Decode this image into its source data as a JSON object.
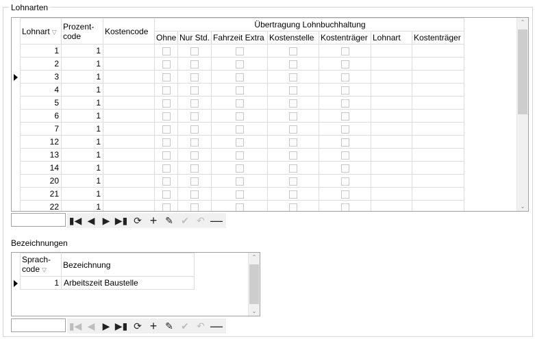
{
  "window": {
    "group_title": "Lohnarten",
    "section2_title": "Bezeichnungen"
  },
  "grid1": {
    "headers": {
      "lohnart": "Lohnart",
      "prozentcode": "Prozent-\ncode",
      "kostencode": "Kostencode",
      "uebertragung": "Übertragung Lohnbuchhaltung",
      "ohne": "Ohne",
      "nur_std": "Nur Std.",
      "fahrzeit_extra": "Fahrzeit Extra",
      "kostenstelle": "Kostenstelle",
      "kostentraeger": "Kostenträger",
      "lohnart2": "Lohnart",
      "kostentraeger2": "Kostenträger"
    },
    "rows": [
      {
        "lohnart": "1",
        "prozentcode": "1"
      },
      {
        "lohnart": "2",
        "prozentcode": "1"
      },
      {
        "lohnart": "3",
        "prozentcode": "1"
      },
      {
        "lohnart": "4",
        "prozentcode": "1"
      },
      {
        "lohnart": "5",
        "prozentcode": "1"
      },
      {
        "lohnart": "6",
        "prozentcode": "1"
      },
      {
        "lohnart": "7",
        "prozentcode": "1"
      },
      {
        "lohnart": "12",
        "prozentcode": "1"
      },
      {
        "lohnart": "13",
        "prozentcode": "1"
      },
      {
        "lohnart": "14",
        "prozentcode": "1"
      },
      {
        "lohnart": "20",
        "prozentcode": "1"
      },
      {
        "lohnart": "21",
        "prozentcode": "1"
      },
      {
        "lohnart": "22",
        "prozentcode": "1"
      }
    ],
    "current_row": 2
  },
  "grid2": {
    "headers": {
      "sprachcode": "Sprach-\ncode",
      "bezeichnung": "Bezeichnung"
    },
    "rows": [
      {
        "sprachcode": "1",
        "bezeichnung": "Arbeitszeit Baustelle"
      }
    ],
    "current_row": 0
  },
  "icons": [
    "first-icon",
    "prev-icon",
    "next-icon",
    "last-icon",
    "refresh-icon",
    "add-icon",
    "edit-icon",
    "check-icon",
    "undo-icon",
    "delete-icon"
  ]
}
